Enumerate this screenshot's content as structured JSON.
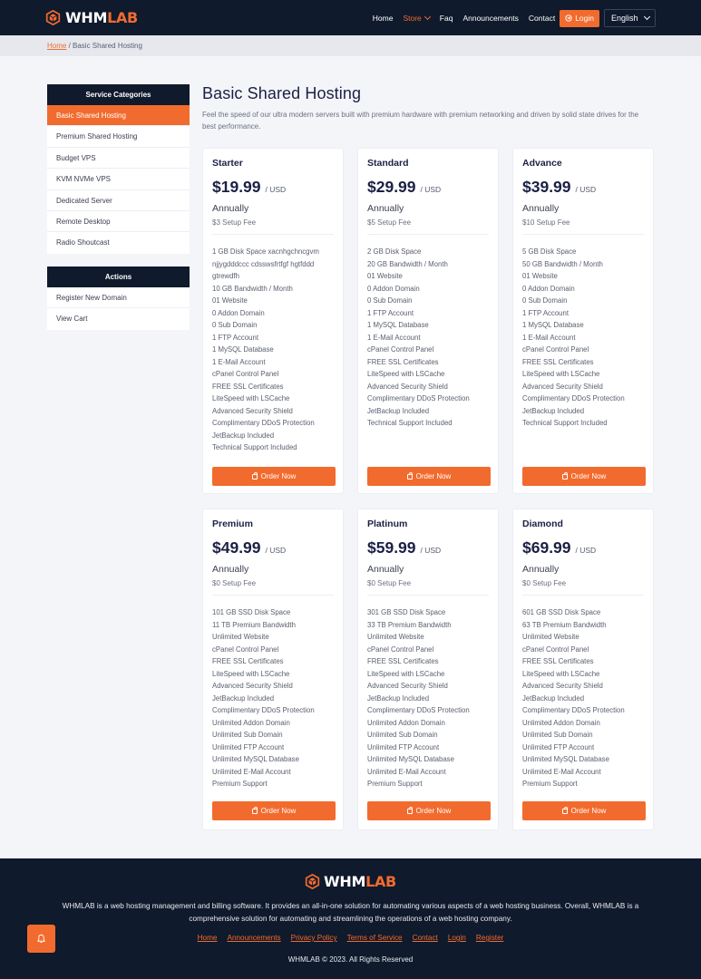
{
  "header": {
    "logo_white": "WHM",
    "logo_orange": "LAB",
    "nav": [
      "Home",
      "Store",
      "Faq",
      "Announcements",
      "Contact"
    ],
    "login": "Login",
    "language": "English"
  },
  "breadcrumb": {
    "home": "Home",
    "sep": " / ",
    "current": "Basic Shared Hosting"
  },
  "sidebar": {
    "categories_title": "Service Categories",
    "categories": [
      "Basic Shared Hosting",
      "Premium Shared Hosting",
      "Budget VPS",
      "KVM NVMe VPS",
      "Dedicated Server",
      "Remote Desktop",
      "Radio Shoutcast"
    ],
    "actions_title": "Actions",
    "actions": [
      "Register New Domain",
      "View Cart"
    ]
  },
  "main": {
    "title": "Basic Shared Hosting",
    "description": "Feel the speed of our ultra modern servers built with premium hardware with premium networking and driven by solid state drives for the best performance."
  },
  "products": [
    {
      "name": "Starter",
      "price": "$19.99",
      "unit": "/ USD",
      "cycle": "Annually",
      "setup": "$3 Setup Fee",
      "features": [
        "1 GB Disk Space xacnhgchncgvm",
        "njjygdddccc cdsswsfrtfgf hgtfddd",
        "gtrewdfh",
        "10 GB Bandwidth / Month",
        "01 Website",
        "0 Addon Domain",
        "0 Sub Domain",
        "1 FTP Account",
        "1 MySQL Database",
        "1 E-Mail Account",
        "cPanel Control Panel",
        "FREE SSL Certificates",
        "LiteSpeed with LSCache",
        "Advanced Security Shield",
        "Complimentary DDoS Protection",
        "JetBackup Included",
        "Technical Support Included"
      ],
      "button": "Order Now"
    },
    {
      "name": "Standard",
      "price": "$29.99",
      "unit": "/ USD",
      "cycle": "Annually",
      "setup": "$5 Setup Fee",
      "features": [
        "2 GB Disk Space",
        "20 GB Bandwidth / Month",
        "01 Website",
        "0 Addon Domain",
        "0 Sub Domain",
        "1 FTP Account",
        "1 MySQL Database",
        "1 E-Mail Account",
        "cPanel Control Panel",
        "FREE SSL Certificates",
        "LiteSpeed with LSCache",
        "Advanced Security Shield",
        "Complimentary DDoS Protection",
        "JetBackup Included",
        "Technical Support Included"
      ],
      "button": "Order Now"
    },
    {
      "name": "Advance",
      "price": "$39.99",
      "unit": "/ USD",
      "cycle": "Annually",
      "setup": "$10 Setup Fee",
      "features": [
        "5 GB Disk Space",
        "50 GB Bandwidth / Month",
        "01 Website",
        "0 Addon Domain",
        "0 Sub Domain",
        "1 FTP Account",
        "1 MySQL Database",
        "1 E-Mail Account",
        "cPanel Control Panel",
        "FREE SSL Certificates",
        "LiteSpeed with LSCache",
        "Advanced Security Shield",
        "Complimentary DDoS Protection",
        "JetBackup Included",
        "Technical Support Included"
      ],
      "button": "Order Now"
    },
    {
      "name": "Premium",
      "price": "$49.99",
      "unit": "/ USD",
      "cycle": "Annually",
      "setup": "$0 Setup Fee",
      "features": [
        "101 GB SSD Disk Space",
        "11 TB Premium Bandwidth",
        "Unlimited Website",
        "cPanel Control Panel",
        "FREE SSL Certificates",
        "LiteSpeed with LSCache",
        "Advanced Security Shield",
        "JetBackup Included",
        "Complimentary DDoS Protection",
        "Unlimited Addon Domain",
        "Unlimited Sub Domain",
        "Unlimited FTP Account",
        "Unlimited MySQL Database",
        "Unlimited E-Mail Account",
        "Premium Support"
      ],
      "button": "Order Now"
    },
    {
      "name": "Platinum",
      "price": "$59.99",
      "unit": "/ USD",
      "cycle": "Annually",
      "setup": "$0 Setup Fee",
      "features": [
        "301 GB SSD Disk Space",
        "33 TB Premium Bandwidth",
        "Unlimited Website",
        "cPanel Control Panel",
        "FREE SSL Certificates",
        "LiteSpeed with LSCache",
        "Advanced Security Shield",
        "JetBackup Included",
        "Complimentary DDoS Protection",
        "Unlimited Addon Domain",
        "Unlimited Sub Domain",
        "Unlimited FTP Account",
        "Unlimited MySQL Database",
        "Unlimited E-Mail Account",
        "Premium Support"
      ],
      "button": "Order Now"
    },
    {
      "name": "Diamond",
      "price": "$69.99",
      "unit": "/ USD",
      "cycle": "Annually",
      "setup": "$0 Setup Fee",
      "features": [
        "601 GB SSD Disk Space",
        "63 TB Premium Bandwidth",
        "Unlimited Website",
        "cPanel Control Panel",
        "FREE SSL Certificates",
        "LiteSpeed with LSCache",
        "Advanced Security Shield",
        "JetBackup Included",
        "Complimentary DDoS Protection",
        "Unlimited Addon Domain",
        "Unlimited Sub Domain",
        "Unlimited FTP Account",
        "Unlimited MySQL Database",
        "Unlimited E-Mail Account",
        "Premium Support"
      ],
      "button": "Order Now"
    }
  ],
  "footer": {
    "description": "WHMLAB is a web hosting management and billing software. It provides an all-in-one solution for automating various aspects of a web hosting business. Overall, WHMLAB is a comprehensive solution for automating and streamlining the operations of a web hosting company.",
    "links": [
      "Home",
      "Announcements",
      "Privacy Policy",
      "Terms of Service",
      "Contact",
      "Login",
      "Register"
    ],
    "copyright": "WHMLAB © 2023. All Rights Reserved"
  },
  "icons": {
    "logo": "cube-logo-icon",
    "login": "login-icon",
    "order": "shopping-bag-icon",
    "notification": "bell-icon",
    "dropdown": "chevron-down-icon"
  },
  "colors": {
    "accent": "#f26b2e",
    "navy": "#0f1a2c",
    "background": "#f4f5f9"
  }
}
